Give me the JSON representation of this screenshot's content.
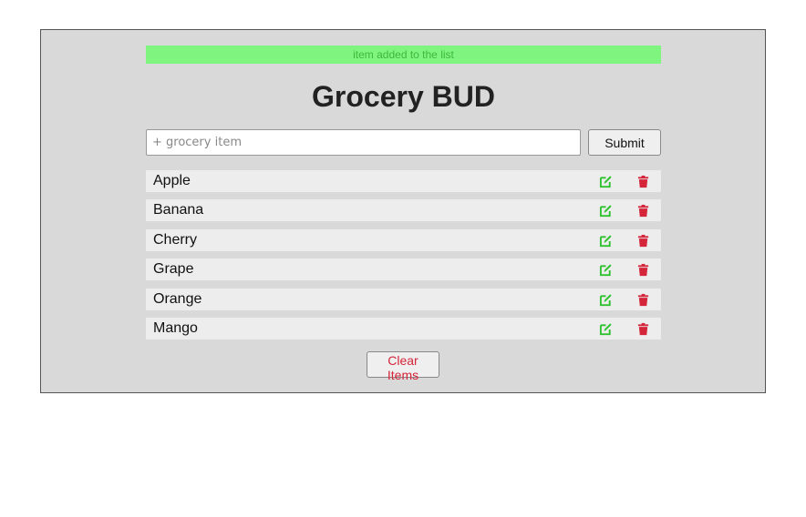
{
  "alert": {
    "text": "item added to the list"
  },
  "header": {
    "title": "Grocery BUD"
  },
  "form": {
    "placeholder": "+ grocery item",
    "value": "",
    "submit_label": "Submit"
  },
  "items": [
    {
      "name": "Apple"
    },
    {
      "name": "Banana"
    },
    {
      "name": "Cherry"
    },
    {
      "name": "Grape"
    },
    {
      "name": "Orange"
    },
    {
      "name": "Mango"
    }
  ],
  "icons": {
    "edit": "edit-icon",
    "delete": "trash-icon"
  },
  "colors": {
    "alert_bg": "#7ff57f",
    "alert_text": "#3cb83c",
    "edit": "#2ec22e",
    "delete": "#d4253a",
    "panel_bg": "#d9d9d9"
  },
  "footer": {
    "clear_label": "Clear Items"
  }
}
